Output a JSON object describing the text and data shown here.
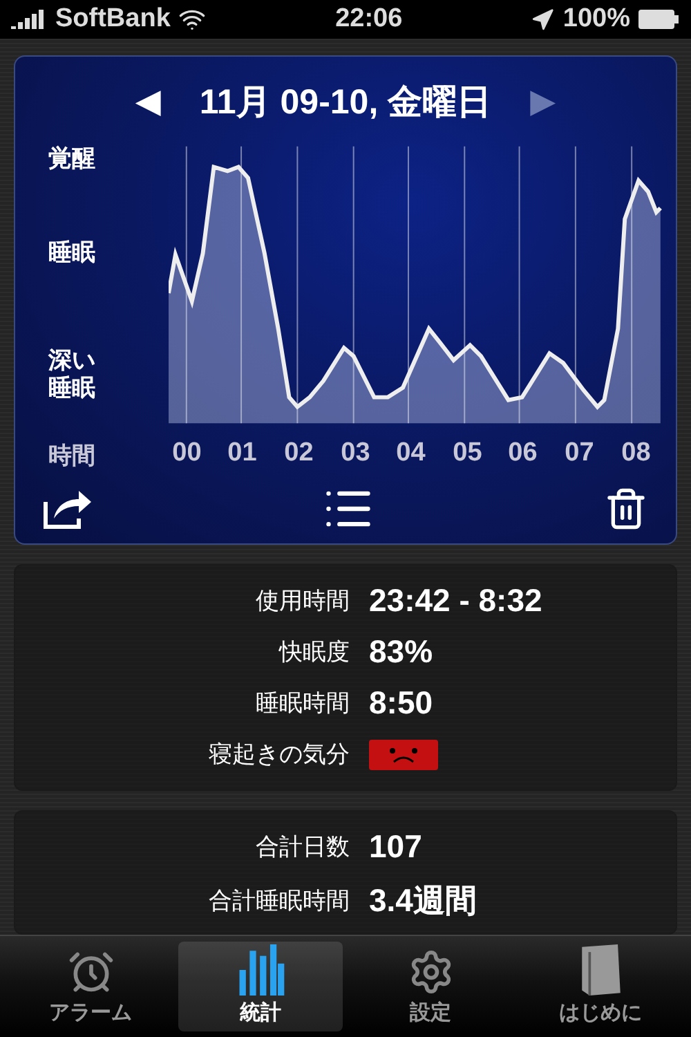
{
  "status_bar": {
    "carrier": "SoftBank",
    "time": "22:06",
    "battery": "100%"
  },
  "chart_card": {
    "nav": [
      {
        "label": "◀",
        "disabled": false
      },
      {
        "label": "▶",
        "disabled": true
      }
    ],
    "title": "11月 09-10, 金曜日",
    "y_labels": [
      "覚醒",
      "睡眠",
      "深い睡眠"
    ],
    "x_axis_label": "時間",
    "hours": [
      "00",
      "01",
      "02",
      "03",
      "04",
      "05",
      "06",
      "07",
      "08"
    ]
  },
  "summary": [
    {
      "label": "使用時間",
      "kind": "text",
      "value": "23:42 - 8:32"
    },
    {
      "label": "快眠度",
      "kind": "text",
      "value": "83%"
    },
    {
      "label": "睡眠時間",
      "kind": "text",
      "value": "8:50"
    },
    {
      "label": "寝起きの気分",
      "kind": "mood"
    }
  ],
  "totals": [
    {
      "label": "合計日数",
      "value": "107"
    },
    {
      "label": "合計睡眠時間",
      "value": "3.4週間"
    }
  ],
  "tabs": [
    {
      "label": "アラーム",
      "selected": false
    },
    {
      "label": "統計",
      "selected": true
    },
    {
      "label": "設定",
      "selected": false
    },
    {
      "label": "はじめに",
      "selected": false
    }
  ]
}
